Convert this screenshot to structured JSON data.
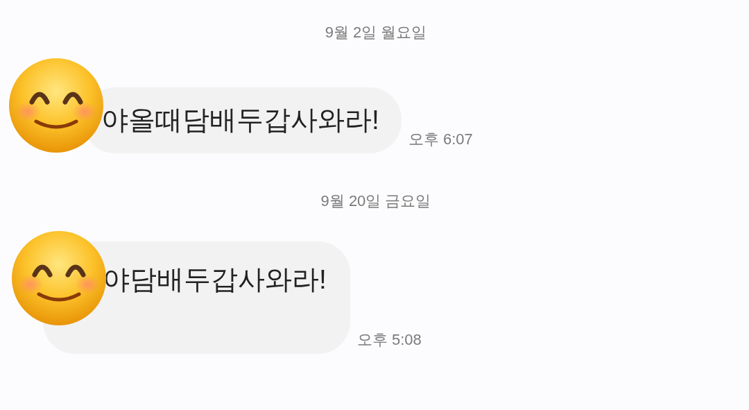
{
  "messages": [
    {
      "date": "9월 2일 월요일",
      "text": "야올때담배두갑사와라!",
      "time": "오후 6:07"
    },
    {
      "date": "9월 20일 금요일",
      "text": "야담배두갑사와라!",
      "time": "오후 5:08"
    }
  ]
}
